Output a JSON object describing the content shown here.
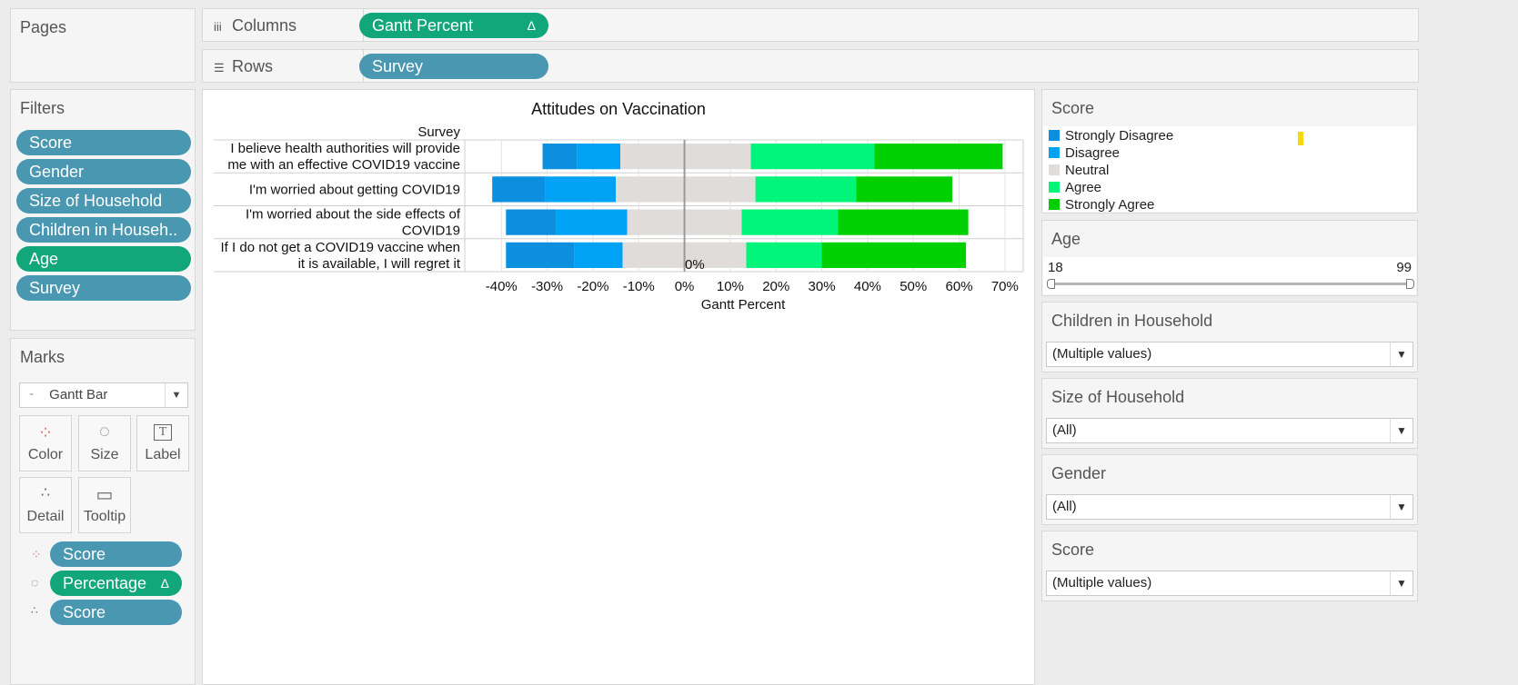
{
  "shelves": {
    "pages_title": "Pages",
    "columns_label": "Columns",
    "columns_icon": "iii",
    "columns_pill": "Gantt Percent",
    "columns_pill_delta": "Δ",
    "rows_label": "Rows",
    "rows_pill": "Survey"
  },
  "filters": {
    "title": "Filters",
    "items": [
      "Score",
      "Gender",
      "Size of Household",
      "Children in Househ..",
      "Age",
      "Survey"
    ]
  },
  "marks": {
    "title": "Marks",
    "mark_type": "Gantt Bar",
    "buttons": [
      "Color",
      "Size",
      "Label",
      "Detail",
      "Tooltip"
    ],
    "pills": [
      {
        "label": "Score",
        "delta": ""
      },
      {
        "label": "Percentage",
        "delta": "Δ"
      },
      {
        "label": "Score",
        "delta": ""
      }
    ]
  },
  "chart_data": {
    "type": "bar",
    "title": "Attitudes on Vaccination",
    "row_header": "Survey",
    "xlabel": "Gantt Percent",
    "ylabel": "",
    "xlim": [
      -0.48,
      0.74
    ],
    "x_ticks": [
      "-40%",
      "-30%",
      "-20%",
      "-10%",
      "0%",
      "10%",
      "20%",
      "30%",
      "40%",
      "50%",
      "60%",
      "70%"
    ],
    "zero_annotation": "0%",
    "grid": true,
    "categories": [
      [
        "I believe health authorities will provide",
        "me with an effective COVID19 vaccine"
      ],
      [
        "I'm worried about getting COVID19"
      ],
      [
        "I'm worried about the side effects of",
        "COVID19"
      ],
      [
        "If I do not get a COVID19 vaccine when",
        "it is available, I will regret it"
      ]
    ],
    "series": [
      {
        "name": "Strongly Disagree",
        "color": "#0b8fde",
        "starts": [
          -0.31,
          -0.42,
          -0.39,
          -0.39
        ],
        "values": [
          0.075,
          0.115,
          0.11,
          0.15
        ]
      },
      {
        "name": "Disagree",
        "color": "#00a2f5",
        "starts": [
          -0.235,
          -0.305,
          -0.28,
          -0.24
        ],
        "values": [
          0.095,
          0.155,
          0.155,
          0.105
        ]
      },
      {
        "name": "Neutral",
        "color": "#e0dcd9",
        "starts": [
          -0.14,
          -0.15,
          -0.125,
          -0.135
        ],
        "values": [
          0.285,
          0.305,
          0.25,
          0.27
        ]
      },
      {
        "name": "Agree",
        "color": "#00f57a",
        "starts": [
          0.145,
          0.155,
          0.125,
          0.135
        ],
        "values": [
          0.27,
          0.22,
          0.21,
          0.165
        ]
      },
      {
        "name": "Strongly Agree",
        "color": "#00d000",
        "starts": [
          0.415,
          0.375,
          0.335,
          0.3
        ],
        "values": [
          0.28,
          0.21,
          0.285,
          0.315
        ]
      }
    ]
  },
  "right_panel": {
    "score_legend_title": "Score",
    "legend": [
      {
        "label": "Strongly Disagree",
        "color": "#0b8fde"
      },
      {
        "label": "Disagree",
        "color": "#00a2f5"
      },
      {
        "label": "Neutral",
        "color": "#e0dcd9"
      },
      {
        "label": "Agree",
        "color": "#00f57a"
      },
      {
        "label": "Strongly Agree",
        "color": "#00d000"
      }
    ],
    "age_title": "Age",
    "age_min": "18",
    "age_max": "99",
    "children_title": "Children in Household",
    "children_value": "(Multiple values)",
    "household_title": "Size of Household",
    "household_value": "(All)",
    "gender_title": "Gender",
    "gender_value": "(All)",
    "score_filter_title": "Score",
    "score_filter_value": "(Multiple values)"
  },
  "colors": {
    "pill_blue": "#4a97b1",
    "pill_green": "#12a77a",
    "highlight_mark": "#f5d90a"
  }
}
